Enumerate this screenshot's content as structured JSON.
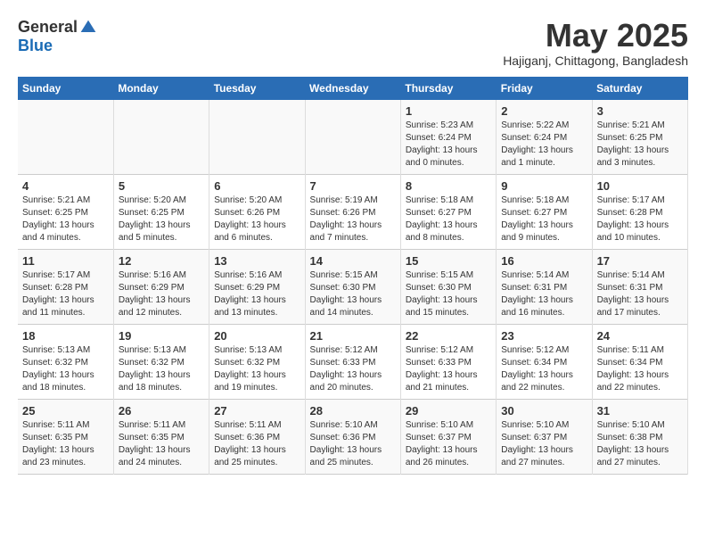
{
  "logo": {
    "general": "General",
    "blue": "Blue"
  },
  "title": {
    "month_year": "May 2025",
    "location": "Hajiganj, Chittagong, Bangladesh"
  },
  "weekdays": [
    "Sunday",
    "Monday",
    "Tuesday",
    "Wednesday",
    "Thursday",
    "Friday",
    "Saturday"
  ],
  "weeks": [
    [
      {
        "day": "",
        "sunrise": "",
        "sunset": "",
        "daylight": ""
      },
      {
        "day": "",
        "sunrise": "",
        "sunset": "",
        "daylight": ""
      },
      {
        "day": "",
        "sunrise": "",
        "sunset": "",
        "daylight": ""
      },
      {
        "day": "",
        "sunrise": "",
        "sunset": "",
        "daylight": ""
      },
      {
        "day": "1",
        "sunrise": "Sunrise: 5:23 AM",
        "sunset": "Sunset: 6:24 PM",
        "daylight": "Daylight: 13 hours and 0 minutes."
      },
      {
        "day": "2",
        "sunrise": "Sunrise: 5:22 AM",
        "sunset": "Sunset: 6:24 PM",
        "daylight": "Daylight: 13 hours and 1 minute."
      },
      {
        "day": "3",
        "sunrise": "Sunrise: 5:21 AM",
        "sunset": "Sunset: 6:25 PM",
        "daylight": "Daylight: 13 hours and 3 minutes."
      }
    ],
    [
      {
        "day": "4",
        "sunrise": "Sunrise: 5:21 AM",
        "sunset": "Sunset: 6:25 PM",
        "daylight": "Daylight: 13 hours and 4 minutes."
      },
      {
        "day": "5",
        "sunrise": "Sunrise: 5:20 AM",
        "sunset": "Sunset: 6:25 PM",
        "daylight": "Daylight: 13 hours and 5 minutes."
      },
      {
        "day": "6",
        "sunrise": "Sunrise: 5:20 AM",
        "sunset": "Sunset: 6:26 PM",
        "daylight": "Daylight: 13 hours and 6 minutes."
      },
      {
        "day": "7",
        "sunrise": "Sunrise: 5:19 AM",
        "sunset": "Sunset: 6:26 PM",
        "daylight": "Daylight: 13 hours and 7 minutes."
      },
      {
        "day": "8",
        "sunrise": "Sunrise: 5:18 AM",
        "sunset": "Sunset: 6:27 PM",
        "daylight": "Daylight: 13 hours and 8 minutes."
      },
      {
        "day": "9",
        "sunrise": "Sunrise: 5:18 AM",
        "sunset": "Sunset: 6:27 PM",
        "daylight": "Daylight: 13 hours and 9 minutes."
      },
      {
        "day": "10",
        "sunrise": "Sunrise: 5:17 AM",
        "sunset": "Sunset: 6:28 PM",
        "daylight": "Daylight: 13 hours and 10 minutes."
      }
    ],
    [
      {
        "day": "11",
        "sunrise": "Sunrise: 5:17 AM",
        "sunset": "Sunset: 6:28 PM",
        "daylight": "Daylight: 13 hours and 11 minutes."
      },
      {
        "day": "12",
        "sunrise": "Sunrise: 5:16 AM",
        "sunset": "Sunset: 6:29 PM",
        "daylight": "Daylight: 13 hours and 12 minutes."
      },
      {
        "day": "13",
        "sunrise": "Sunrise: 5:16 AM",
        "sunset": "Sunset: 6:29 PM",
        "daylight": "Daylight: 13 hours and 13 minutes."
      },
      {
        "day": "14",
        "sunrise": "Sunrise: 5:15 AM",
        "sunset": "Sunset: 6:30 PM",
        "daylight": "Daylight: 13 hours and 14 minutes."
      },
      {
        "day": "15",
        "sunrise": "Sunrise: 5:15 AM",
        "sunset": "Sunset: 6:30 PM",
        "daylight": "Daylight: 13 hours and 15 minutes."
      },
      {
        "day": "16",
        "sunrise": "Sunrise: 5:14 AM",
        "sunset": "Sunset: 6:31 PM",
        "daylight": "Daylight: 13 hours and 16 minutes."
      },
      {
        "day": "17",
        "sunrise": "Sunrise: 5:14 AM",
        "sunset": "Sunset: 6:31 PM",
        "daylight": "Daylight: 13 hours and 17 minutes."
      }
    ],
    [
      {
        "day": "18",
        "sunrise": "Sunrise: 5:13 AM",
        "sunset": "Sunset: 6:32 PM",
        "daylight": "Daylight: 13 hours and 18 minutes."
      },
      {
        "day": "19",
        "sunrise": "Sunrise: 5:13 AM",
        "sunset": "Sunset: 6:32 PM",
        "daylight": "Daylight: 13 hours and 18 minutes."
      },
      {
        "day": "20",
        "sunrise": "Sunrise: 5:13 AM",
        "sunset": "Sunset: 6:32 PM",
        "daylight": "Daylight: 13 hours and 19 minutes."
      },
      {
        "day": "21",
        "sunrise": "Sunrise: 5:12 AM",
        "sunset": "Sunset: 6:33 PM",
        "daylight": "Daylight: 13 hours and 20 minutes."
      },
      {
        "day": "22",
        "sunrise": "Sunrise: 5:12 AM",
        "sunset": "Sunset: 6:33 PM",
        "daylight": "Daylight: 13 hours and 21 minutes."
      },
      {
        "day": "23",
        "sunrise": "Sunrise: 5:12 AM",
        "sunset": "Sunset: 6:34 PM",
        "daylight": "Daylight: 13 hours and 22 minutes."
      },
      {
        "day": "24",
        "sunrise": "Sunrise: 5:11 AM",
        "sunset": "Sunset: 6:34 PM",
        "daylight": "Daylight: 13 hours and 22 minutes."
      }
    ],
    [
      {
        "day": "25",
        "sunrise": "Sunrise: 5:11 AM",
        "sunset": "Sunset: 6:35 PM",
        "daylight": "Daylight: 13 hours and 23 minutes."
      },
      {
        "day": "26",
        "sunrise": "Sunrise: 5:11 AM",
        "sunset": "Sunset: 6:35 PM",
        "daylight": "Daylight: 13 hours and 24 minutes."
      },
      {
        "day": "27",
        "sunrise": "Sunrise: 5:11 AM",
        "sunset": "Sunset: 6:36 PM",
        "daylight": "Daylight: 13 hours and 25 minutes."
      },
      {
        "day": "28",
        "sunrise": "Sunrise: 5:10 AM",
        "sunset": "Sunset: 6:36 PM",
        "daylight": "Daylight: 13 hours and 25 minutes."
      },
      {
        "day": "29",
        "sunrise": "Sunrise: 5:10 AM",
        "sunset": "Sunset: 6:37 PM",
        "daylight": "Daylight: 13 hours and 26 minutes."
      },
      {
        "day": "30",
        "sunrise": "Sunrise: 5:10 AM",
        "sunset": "Sunset: 6:37 PM",
        "daylight": "Daylight: 13 hours and 27 minutes."
      },
      {
        "day": "31",
        "sunrise": "Sunrise: 5:10 AM",
        "sunset": "Sunset: 6:38 PM",
        "daylight": "Daylight: 13 hours and 27 minutes."
      }
    ]
  ]
}
